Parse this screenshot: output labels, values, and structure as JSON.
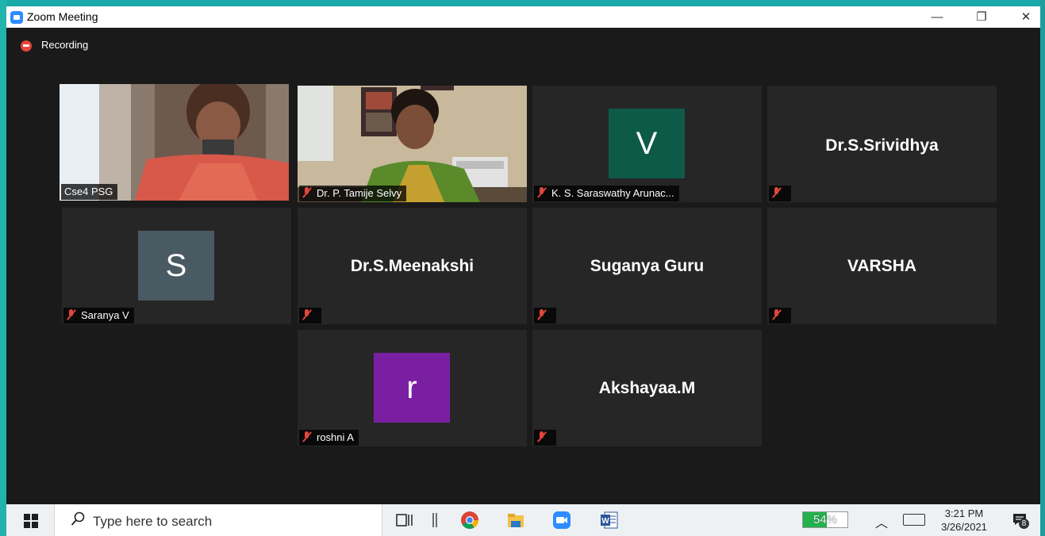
{
  "window": {
    "title": "Zoom Meeting",
    "minimize_glyph": "—",
    "maximize_glyph": "❐",
    "close_glyph": "✕"
  },
  "recording": {
    "label": "Recording"
  },
  "participants": [
    {
      "name": "Cse4 PSG",
      "type": "video",
      "active": true,
      "muted": false
    },
    {
      "name": "Dr. P. Tamije Selvy",
      "type": "video",
      "active": false,
      "muted": true
    },
    {
      "name": "K. S. Saraswathy Arunac...",
      "type": "avatar",
      "initial": "V",
      "avatar_color": "#0e5a48",
      "muted": true
    },
    {
      "name": "Dr.S.Srividhya",
      "type": "name",
      "muted": true
    },
    {
      "name": "Saranya V",
      "type": "avatar",
      "initial": "S",
      "avatar_color": "#4a5a62",
      "muted": true
    },
    {
      "name": "Dr.S.Meenakshi",
      "type": "name",
      "muted": true
    },
    {
      "name": "Suganya Guru",
      "type": "name",
      "muted": true
    },
    {
      "name": "VARSHA",
      "type": "name",
      "muted": true
    },
    {
      "name": "roshni A",
      "type": "avatar",
      "initial": "r",
      "avatar_color": "#7b1fa2",
      "muted": true
    },
    {
      "name": "Akshayaa.M",
      "type": "name",
      "muted": true
    }
  ],
  "taskbar": {
    "search_placeholder": "Type here to search",
    "battery_percent": 54,
    "battery_label": "54%",
    "tray_up_glyph": "︿",
    "time": "3:21 PM",
    "date": "3/26/2021",
    "notification_count": "8"
  },
  "colors": {
    "active_speaker_border": "#e3e57b",
    "muted_mic": "#e0463c",
    "tile_background": "#262626"
  }
}
